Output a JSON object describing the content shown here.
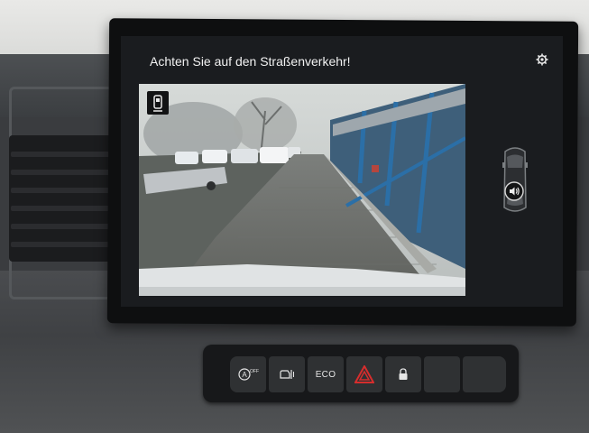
{
  "screen": {
    "title": "Achten Sie auf den Straßenverkehr!",
    "settings_icon": "gear-icon",
    "camera_icon": "parking-camera-icon",
    "sensor_panel": {
      "car_icon": "car-top-view-icon",
      "sound_icon": "speaker-icon"
    }
  },
  "buttons": [
    {
      "icon": "auto-start-stop-off-icon",
      "label": "Ⓐ"
    },
    {
      "icon": "parking-assist-icon",
      "label": ""
    },
    {
      "icon": "eco-icon",
      "label": "ECO"
    },
    {
      "icon": "hazard-warning-icon",
      "label": ""
    },
    {
      "icon": "lock-icon",
      "label": ""
    },
    {
      "icon": "blank-button-1",
      "label": ""
    },
    {
      "icon": "blank-button-2",
      "label": ""
    }
  ],
  "colors": {
    "hazard": "#d62d2d",
    "screen_bg": "#1a1c1f"
  }
}
